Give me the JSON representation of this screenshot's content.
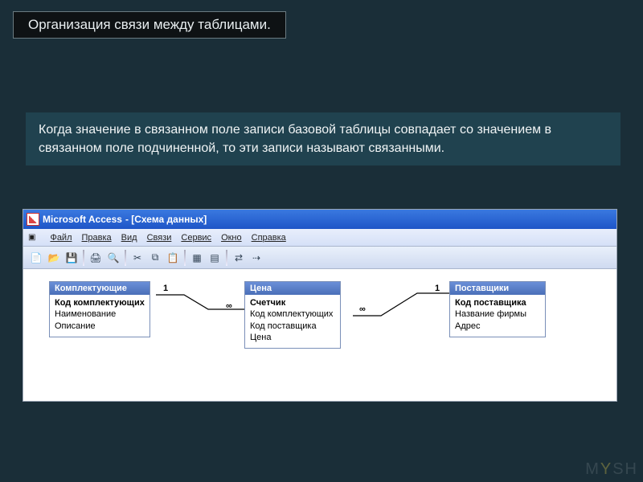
{
  "slide": {
    "title": "Организация связи между таблицами.",
    "text": "Когда значение в связанном поле записи базовой таблицы совпадает со значением в связанном поле подчиненной, то эти записи называют связанными."
  },
  "access": {
    "titlebar_app": "Microsoft Access",
    "titlebar_doc": "- [Схема данных]",
    "menu": {
      "file": "Файл",
      "edit": "Правка",
      "view": "Вид",
      "relations": "Связи",
      "tools": "Сервис",
      "window": "Окно",
      "help": "Справка"
    },
    "tables": {
      "t1": {
        "title": "Комплектующие",
        "f1": "Код комплектующих",
        "f2": "Наименование",
        "f3": "Описание"
      },
      "t2": {
        "title": "Цена",
        "f1": "Счетчик",
        "f2": "Код комплектующих",
        "f3": "Код поставщика",
        "f4": "Цена"
      },
      "t3": {
        "title": "Поставщики",
        "f1": "Код поставщика",
        "f2": "Название фирмы",
        "f3": "Адрес"
      }
    },
    "rel": {
      "one_a": "1",
      "many_a": "∞",
      "many_b": "∞",
      "one_b": "1"
    }
  },
  "watermark": "M SH"
}
